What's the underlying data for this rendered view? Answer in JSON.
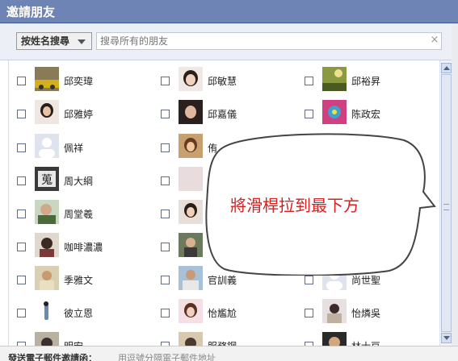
{
  "dialog": {
    "title": "邀請朋友"
  },
  "search": {
    "filter_label": "按姓名搜尋",
    "placeholder": "搜尋所有的朋友",
    "clear": "×"
  },
  "friends": {
    "col1": [
      "邱奕瑋",
      "邱雅婷",
      "佩祥",
      "周大綱",
      "周堂羲",
      "咖啡濃濃",
      "季雅文",
      "彼立恩",
      "明宏"
    ],
    "col2": [
      "邱敏慧",
      "邱嘉儀",
      "侑",
      "",
      "",
      "",
      "官訓義",
      "怡尷尬",
      "服務鋼"
    ],
    "col3": [
      "邱裕昇",
      "陈政宏",
      "",
      "",
      "",
      "",
      "尚世聖",
      "怡燐吳",
      "林士豆"
    ]
  },
  "callout": {
    "text": "將滑桿拉到最下方"
  },
  "footer": {
    "label": "發送電子郵件邀請函：",
    "hint": "用逗號分隔電子郵件地址"
  },
  "colors": {
    "title_bar": "#6d84b4",
    "callout_text": "#d91f1f"
  }
}
